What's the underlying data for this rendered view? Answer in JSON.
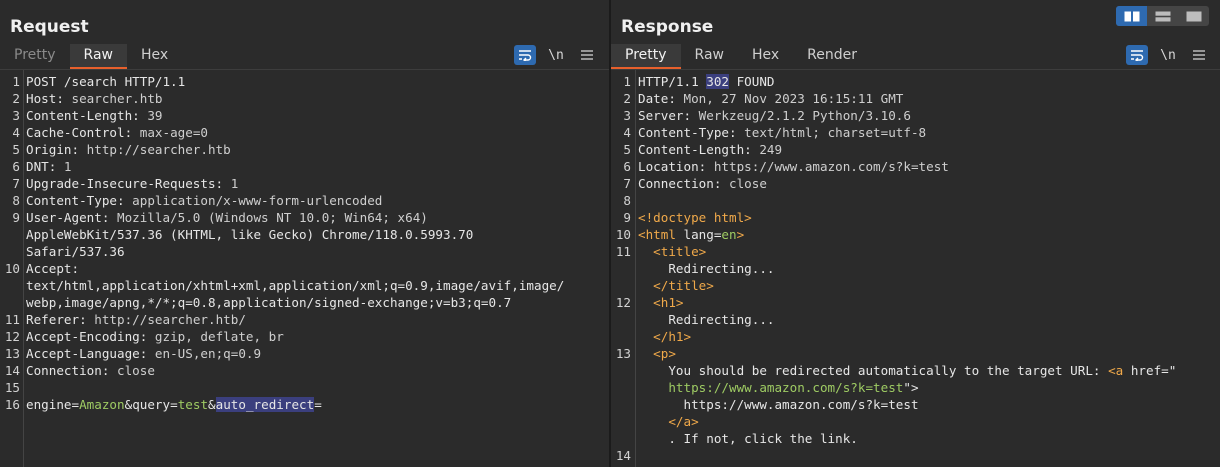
{
  "request": {
    "title": "Request",
    "tabs": [
      {
        "label": "Pretty",
        "state": "dim"
      },
      {
        "label": "Raw",
        "state": "active"
      },
      {
        "label": "Hex",
        "state": "normal"
      }
    ],
    "tools": {
      "wrap_icon": "wrap-lines-icon",
      "newline_label": "\\n",
      "menu_icon": "hamburger-menu-icon"
    },
    "lines": [
      {
        "n": "1",
        "text": "POST /search HTTP/1.1"
      },
      {
        "n": "2",
        "key": "Host:",
        "val": " searcher.htb"
      },
      {
        "n": "3",
        "key": "Content-Length:",
        "val": " 39"
      },
      {
        "n": "4",
        "key": "Cache-Control:",
        "val": " max-age=0"
      },
      {
        "n": "5",
        "key": "Origin:",
        "val": " http://searcher.htb"
      },
      {
        "n": "6",
        "key": "DNT:",
        "val": " 1"
      },
      {
        "n": "7",
        "key": "Upgrade-Insecure-Requests:",
        "val": " 1"
      },
      {
        "n": "8",
        "key": "Content-Type:",
        "val": " application/x-www-form-urlencoded"
      },
      {
        "n": "9",
        "key": "User-Agent:",
        "val": " Mozilla/5.0 (Windows NT 10.0; Win64; x64)"
      },
      {
        "n": "",
        "text": "AppleWebKit/537.36 (KHTML, like Gecko) Chrome/118.0.5993.70"
      },
      {
        "n": "",
        "text": "Safari/537.36"
      },
      {
        "n": "10",
        "key": "Accept:",
        "val": ""
      },
      {
        "n": "",
        "text": "text/html,application/xhtml+xml,application/xml;q=0.9,image/avif,image/"
      },
      {
        "n": "",
        "text": "webp,image/apng,*/*;q=0.8,application/signed-exchange;v=b3;q=0.7"
      },
      {
        "n": "11",
        "key": "Referer:",
        "val": " http://searcher.htb/"
      },
      {
        "n": "12",
        "key": "Accept-Encoding:",
        "val": " gzip, deflate, br"
      },
      {
        "n": "13",
        "key": "Accept-Language:",
        "val": " en-US,en;q=0.9"
      },
      {
        "n": "14",
        "key": "Connection:",
        "val": " close"
      },
      {
        "n": "15",
        "text": ""
      }
    ],
    "body_line": {
      "n": "16",
      "p1_key": "engine",
      "eq1": "=",
      "p1_val": "Amazon",
      "amp1": "&",
      "p2_key": "query",
      "eq2": "=",
      "p2_val": "test",
      "amp2": "&",
      "p3_key": "auto_redirect",
      "eq3": "="
    }
  },
  "response": {
    "title": "Response",
    "tabs": [
      {
        "label": "Pretty",
        "state": "active"
      },
      {
        "label": "Raw",
        "state": "normal"
      },
      {
        "label": "Hex",
        "state": "normal"
      },
      {
        "label": "Render",
        "state": "normal"
      }
    ],
    "tools": {
      "wrap_icon": "wrap-lines-icon",
      "newline_label": "\\n",
      "menu_icon": "hamburger-menu-icon"
    },
    "status": {
      "n": "1",
      "proto": "HTTP/1.1 ",
      "code": "302",
      "reason": " FOUND"
    },
    "headers": [
      {
        "n": "2",
        "key": "Date:",
        "val": " Mon, 27 Nov 2023 16:15:11 GMT"
      },
      {
        "n": "3",
        "key": "Server:",
        "val": " Werkzeug/2.1.2 Python/3.10.6"
      },
      {
        "n": "4",
        "key": "Content-Type:",
        "val": " text/html; charset=utf-8"
      },
      {
        "n": "5",
        "key": "Content-Length:",
        "val": " 249"
      },
      {
        "n": "6",
        "key": "Location:",
        "val": " https://www.amazon.com/s?k=test"
      },
      {
        "n": "7",
        "key": "Connection:",
        "val": " close"
      },
      {
        "n": "8",
        "key": "",
        "val": ""
      }
    ],
    "html": {
      "l9": {
        "n": "9",
        "text": "<!doctype html>"
      },
      "l10": {
        "n": "10",
        "open": "<html",
        "attr": " lang=",
        "val": "en",
        "close": ">"
      },
      "l11a": {
        "n": "11",
        "text": "  <title>"
      },
      "l11b": {
        "n": "",
        "text": "    Redirecting..."
      },
      "l11c": {
        "n": "",
        "text": "  </title>"
      },
      "l12a": {
        "n": "12",
        "text": "  <h1>"
      },
      "l12b": {
        "n": "",
        "text": "    Redirecting..."
      },
      "l12c": {
        "n": "",
        "text": "  </h1>"
      },
      "l13a": {
        "n": "13",
        "text": "  <p>"
      },
      "l13b": {
        "n": "",
        "pre": "    You should be redirected automatically to the target URL: ",
        "open": "<a",
        "attr": " href=",
        "q": "\""
      },
      "l13c": {
        "n": "",
        "val": "    https://www.amazon.com/s?k=test",
        "close": "\">"
      },
      "l13d": {
        "n": "",
        "text": "      https://www.amazon.com/s?k=test"
      },
      "l13e": {
        "n": "",
        "text": "    </a>"
      },
      "l13f": {
        "n": "",
        "text": "    . If not, click the link."
      },
      "l14": {
        "n": "14",
        "text": ""
      }
    }
  },
  "layout_buttons": [
    {
      "icon": "side-by-side-layout-icon",
      "state": "on"
    },
    {
      "icon": "stacked-layout-icon",
      "state": "off"
    },
    {
      "icon": "single-pane-layout-icon",
      "state": "off"
    }
  ],
  "colors": {
    "accent": "#e8602c",
    "selected_tool": "#2e6ab0",
    "highlight": "#3b3f7e",
    "string_green": "#9ecb63",
    "tag_orange": "#f0a94a"
  }
}
